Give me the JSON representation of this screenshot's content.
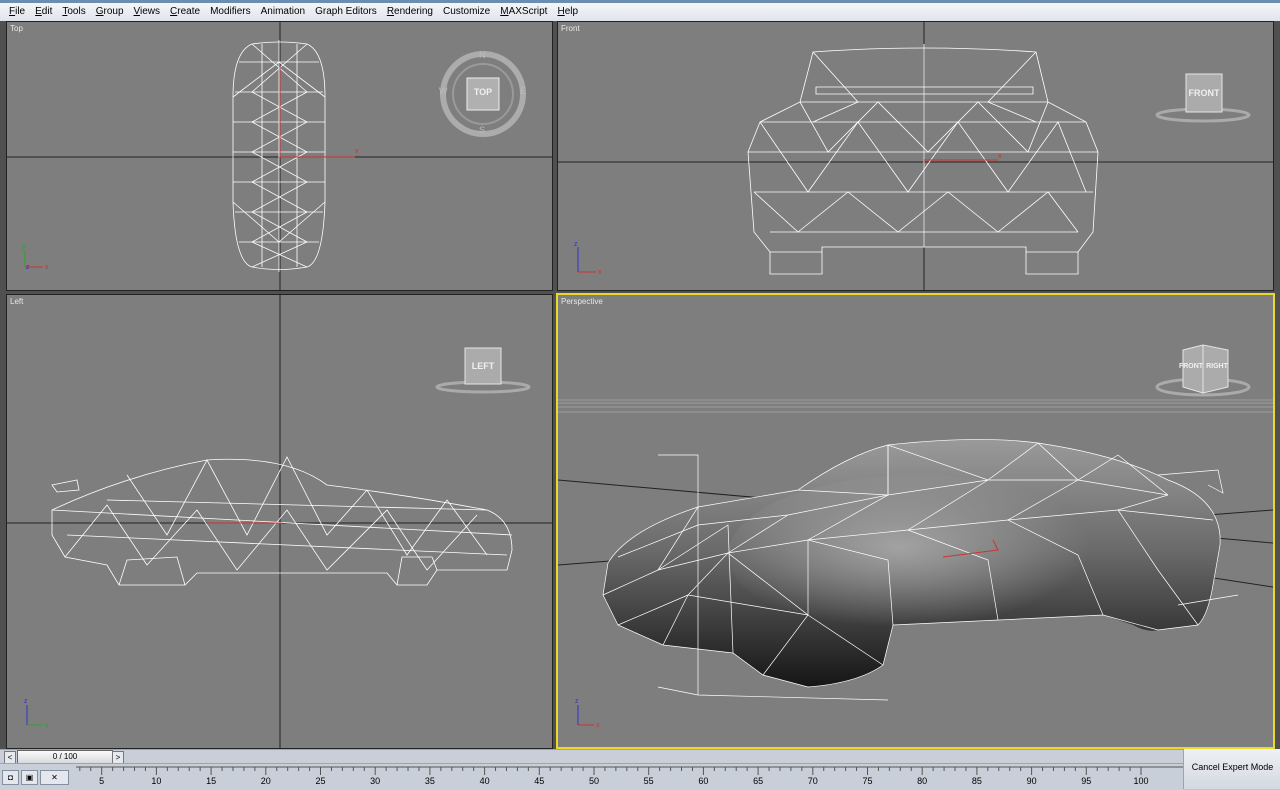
{
  "menu": [
    {
      "pre": "",
      "u": "F",
      "post": "ile"
    },
    {
      "pre": "",
      "u": "E",
      "post": "dit"
    },
    {
      "pre": "",
      "u": "T",
      "post": "ools"
    },
    {
      "pre": "",
      "u": "G",
      "post": "roup"
    },
    {
      "pre": "",
      "u": "V",
      "post": "iews"
    },
    {
      "pre": "",
      "u": "C",
      "post": "reate"
    },
    {
      "pre": "",
      "u": "",
      "post": "Modifiers"
    },
    {
      "pre": "",
      "u": "",
      "post": "Animation"
    },
    {
      "pre": "",
      "u": "",
      "post": "Graph Editors"
    },
    {
      "pre": "",
      "u": "R",
      "post": "endering"
    },
    {
      "pre": "",
      "u": "",
      "post": "Customize"
    },
    {
      "pre": "",
      "u": "M",
      "post": "AXScript"
    },
    {
      "pre": "",
      "u": "H",
      "post": "elp"
    }
  ],
  "viewports": {
    "top": {
      "label": "Top",
      "cube": "TOP",
      "compass": [
        "N",
        "E",
        "S",
        "W"
      ]
    },
    "front": {
      "label": "Front",
      "cube": "FRONT"
    },
    "left": {
      "label": "Left",
      "cube": "LEFT"
    },
    "perspective": {
      "label": "Perspective",
      "cube_front": "FRONT",
      "cube_right": "RIGHT",
      "active": true
    }
  },
  "time_slider": {
    "text": "0 / 100",
    "left_arrow": "<",
    "right_arrow": ">"
  },
  "timeline": {
    "ticks": [
      5,
      10,
      15,
      20,
      25,
      30,
      35,
      40,
      45,
      50,
      55,
      60,
      65,
      70,
      75,
      80,
      85,
      90,
      95,
      100
    ]
  },
  "expert_button": "Cancel Expert Mode",
  "colors": {
    "active_border": "#e8d92b",
    "viewport_bg": "#7e7e7e",
    "wire": "#ffffff"
  }
}
